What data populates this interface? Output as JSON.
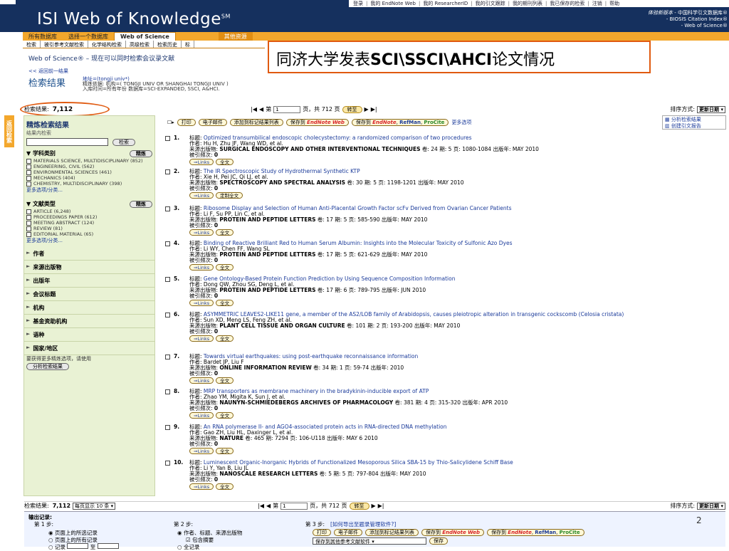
{
  "header": {
    "brand": "ISI Web of Knowledge",
    "brand_sup": "SM",
    "toplinks": [
      "登录",
      "我的 EndNote Web",
      "我的 ResearcherID",
      "我的引文跟踪",
      "我的期刊列表",
      "我已保存的检索",
      "注销",
      "帮助"
    ],
    "trial_label": "体验新版本",
    "trial_lines": [
      "- 中国科学引文数据库®",
      "- BIOSIS Citation Index®",
      "- Web of Science®"
    ]
  },
  "tabs": [
    "所有数据库",
    "选择一个数据库",
    "Web of Science",
    "其他资源"
  ],
  "subtabs": [
    "检索",
    "被引参考文献检索",
    "化学结构检索",
    "高级检索",
    "检索历史",
    "标"
  ],
  "wos_title": "Web of Science® – 现在可以同时检索会议录文献",
  "callout": "同济大学发表SCI\\SSCI\\AHCI论文情况",
  "back_link": "<< 返回前一结果",
  "result_title": "检索结果",
  "result_meta": {
    "line1": "地址=(tongji univ*)",
    "line2": "精炼依据: 机构=( TONGJI UNIV OR SHANGHAI TONGJI UNIV )",
    "line3": "入库时间=所有年份 数据库=SCI-EXPANDED, SSCI, A&HCI."
  },
  "count": {
    "label": "检索结果:",
    "value": "7,112"
  },
  "pager": {
    "prefix": "第",
    "page": "1",
    "suffix": "页，共 712 页",
    "go": "转至"
  },
  "sort": {
    "label": "排序方式:",
    "value": "更新日期"
  },
  "sidebar": {
    "title": "精炼检索结果",
    "subtitle": "结果内检索",
    "search_btn": "检索",
    "refine_btn": "精炼",
    "subject_label": "学科类别",
    "subjects": [
      "MATERIALS SCIENCE, MULTIDISCIPLINARY (852)",
      "ENGINEERING, CIVIL (562)",
      "ENVIRONMENTAL SCIENCES (461)",
      "MECHANICS (404)",
      "CHEMISTRY, MULTIDISCIPLINARY (398)"
    ],
    "more1": "更多选项/分类...",
    "doctype_label": "文献类型",
    "doctypes": [
      "ARTICLE (6,248)",
      "PROCEEDINGS PAPER (612)",
      "MEETING ABSTRACT (124)",
      "REVIEW (81)",
      "EDITORIAL MATERIAL (65)"
    ],
    "more2": "更多选项/分类...",
    "collapsed": [
      "作者",
      "来源出版物",
      "出版年",
      "会议标题",
      "机构",
      "基金资助机构",
      "语种",
      "国家/地区"
    ],
    "note": "要获得更多精炼选项，请使用",
    "analyze_btn": "分析检索结果"
  },
  "tab_side": "返回检索",
  "actions": {
    "print": "打印",
    "email": "电子邮件",
    "add": "添加到标记结果列表",
    "save_to": "保存到",
    "endnote": "EndNote",
    "web": "Web",
    "endnote2": "EndNote",
    "refman": "RefMan",
    "procite": "ProCite",
    "more": "更多选项"
  },
  "right_links": [
    "分析检索结果",
    "创建引文报告"
  ],
  "labels": {
    "title": "标题:",
    "author": "作者:",
    "source": "来源出版物:",
    "cited": "被引频次:",
    "links": "Links",
    "fulltext": "全文",
    "order": "定制全文"
  },
  "records": [
    {
      "n": "1.",
      "title": "Optimized transumbilical endoscopic cholecystectomy: a randomized comparison of two procedures",
      "authors": "Hu H, Zhu JF, Wang WD, et al.",
      "source": "SURGICAL ENDOSCOPY AND OTHER INTERVENTIONAL TECHNIQUES",
      "meta": "卷: 24  期: 5  页: 1080-1084  出版年: MAY 2010",
      "cited": "0",
      "btn2": "全文"
    },
    {
      "n": "2.",
      "title": "The IR Spectroscopic Study of Hydrothermal Synthetic KTP",
      "authors": "Xie H, Pei JC, Qi LJ, et al.",
      "source": "SPECTROSCOPY AND SPECTRAL ANALYSIS",
      "meta": "卷: 30  期: 5  页: 1198-1201  出版年: MAY 2010",
      "cited": "0",
      "btn2": "定制全文"
    },
    {
      "n": "3.",
      "title": "Ribosome Display and Selection of Human Anti-Placental Growth Factor scFv Derived from Ovarian Cancer Patients",
      "authors": "Li F, Su PP, Lin C, et al.",
      "source": "PROTEIN AND PEPTIDE LETTERS",
      "meta": "卷: 17  期: 5  页: 585-590  出版年: MAY 2010",
      "cited": "0",
      "btn2": "全文"
    },
    {
      "n": "4.",
      "title": "Binding of Reactive Brilliant Red to Human Serum Albumin: Insights into the Molecular Toxicity of Sulfonic Azo Dyes",
      "authors": "Li WY, Chen FF, Wang SL",
      "source": "PROTEIN AND PEPTIDE LETTERS",
      "meta": "卷: 17  期: 5  页: 621-629  出版年: MAY 2010",
      "cited": "0",
      "btn2": "全文"
    },
    {
      "n": "5.",
      "title": "Gene Ontology-Based Protein Function Prediction by Using Sequence Composition Information",
      "authors": "Dong QW, Zhou SG, Deng L, et al.",
      "source": "PROTEIN AND PEPTIDE LETTERS",
      "meta": "卷: 17  期: 6  页: 789-795  出版年: JUN 2010",
      "cited": "0",
      "btn2": "全文"
    },
    {
      "n": "6.",
      "title": "ASYMMETRIC LEAVES2-LIKE11 gene, a member of the AS2/LOB family of Arabidopsis, causes pleiotropic alteration in transgenic cockscomb (Celosia cristata)",
      "authors": "Sun XD, Meng LS, Feng ZH, et al.",
      "source": "PLANT CELL TISSUE AND ORGAN CULTURE",
      "meta": "卷: 101  期: 2  页: 193-200  出版年: MAY 2010",
      "cited": "0",
      "btn2": "全文"
    },
    {
      "n": "7.",
      "title": "Towards virtual earthquakes: using post-earthquake reconnaissance information",
      "authors": "Bardet JP, Liu F",
      "source": "ONLINE INFORMATION REVIEW",
      "meta": "卷: 34  期: 1  页: 59-74  出版年: 2010",
      "cited": "0",
      "btn2": "全文"
    },
    {
      "n": "8.",
      "title": "MRP transporters as membrane machinery in the bradykinin-inducible export of ATP",
      "authors": "Zhao YM, Migita K, Sun J, et al.",
      "source": "NAUNYN-SCHMIEDEBERGS ARCHIVES OF PHARMACOLOGY",
      "meta": "卷: 381  期: 4  页: 315-320  出版年: APR 2010",
      "cited": "0",
      "btn2": "全文"
    },
    {
      "n": "9.",
      "title": "An RNA polymerase II- and AGO4-associated protein acts in RNA-directed DNA methylation",
      "authors": "Gao ZH, Liu HL, Daxinger L, et al.",
      "source": "NATURE",
      "meta": "卷: 465  期: 7294  页: 106-U118  出版年: MAY 6 2010",
      "cited": "0",
      "btn2": "全文"
    },
    {
      "n": "10.",
      "title": "Luminescent Organic-Inorganic Hybrids of Functionalized Mesoporous Silica SBA-15 by Thio-Salicylidene Schiff Base",
      "authors": "Li Y, Yan B, Liu JL",
      "source": "NANOSCALE RESEARCH LETTERS",
      "meta": "卷: 5  期: 5  页: 797-804  出版年: MAY 2010",
      "cited": "0",
      "btn2": "全文"
    }
  ],
  "bottom": {
    "per_page": "每页显示 10 条"
  },
  "output": {
    "title": "输出记录:",
    "step1": "第 1 步:",
    "step1_opts": [
      "页面上的所选记录",
      "页面上的所有记录",
      "记录",
      "至"
    ],
    "step2": "第 2 步:",
    "step2_opts": [
      "作者、标题、来源出版物",
      "包含摘要",
      "全记录"
    ],
    "step3": "第 3 步:",
    "step3_link": "[如何导出至题录管理软件?]",
    "step3_select": "保存到其他参考文献软件",
    "save": "保存"
  },
  "page_number": "2"
}
